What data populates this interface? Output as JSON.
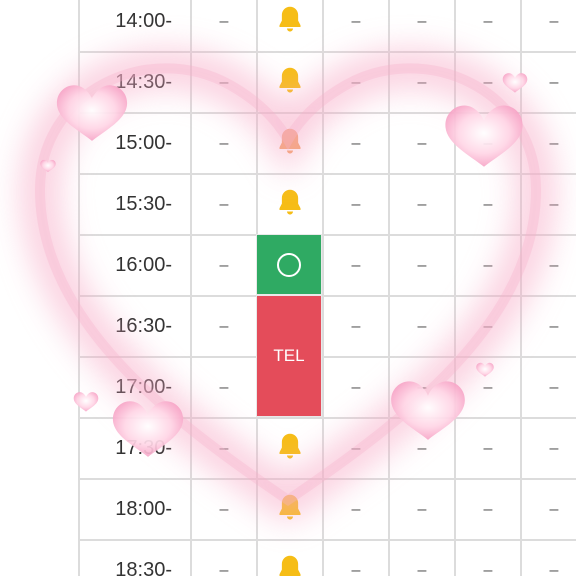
{
  "times": [
    "14:00-",
    "14:30-",
    "15:00-",
    "15:30-",
    "16:00-",
    "16:30-",
    "17:00-",
    "17:30-",
    "18:00-",
    "18:30-"
  ],
  "dash": "–",
  "available_symbol": "○",
  "tel_label": "TEL",
  "icons": {
    "bell": "bell-icon",
    "heart": "heart-icon"
  },
  "colors": {
    "bell": "#f6bd16",
    "available": "#2faa63",
    "tel": "#e44c5a",
    "heart_glow": "#f7a7c4"
  }
}
